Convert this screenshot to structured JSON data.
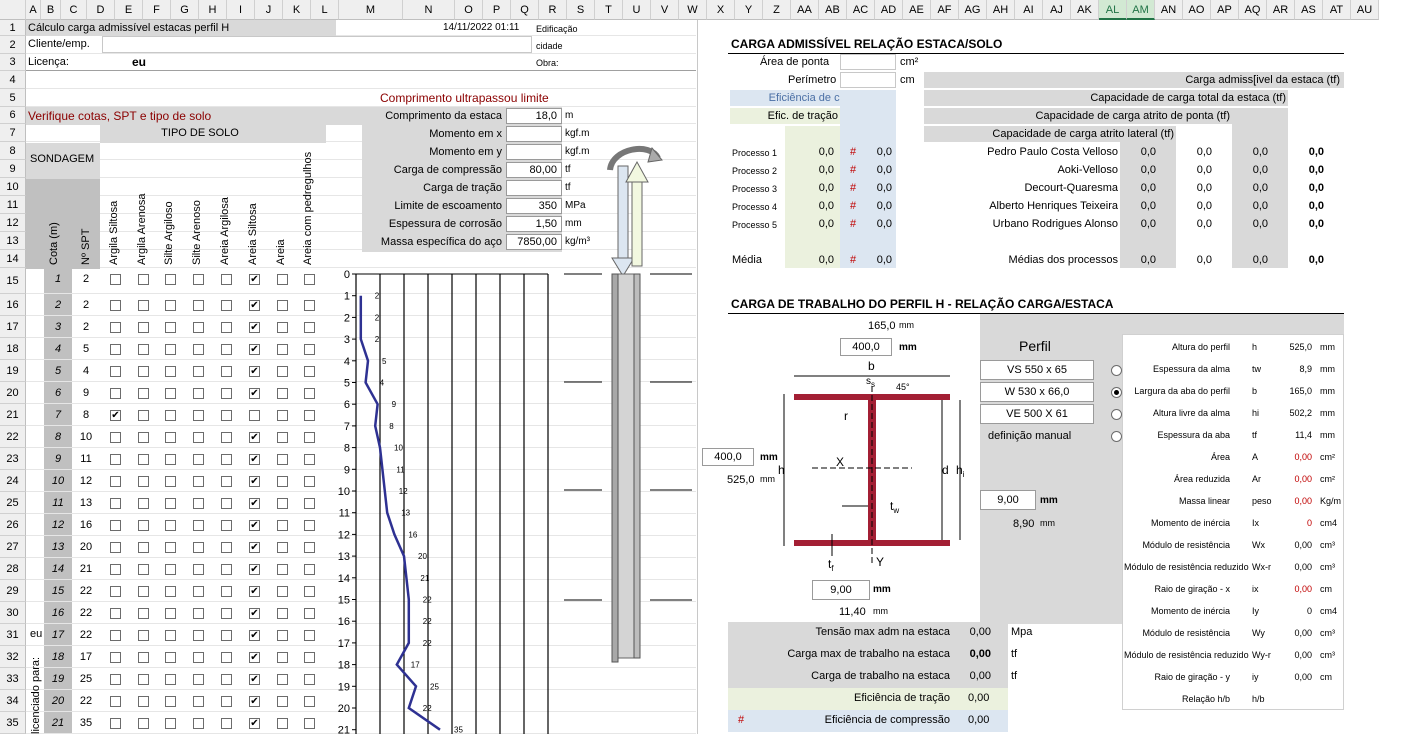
{
  "columns": [
    "A",
    "B",
    "C",
    "D",
    "E",
    "F",
    "G",
    "H",
    "I",
    "J",
    "K",
    "L",
    "M",
    "N",
    "O",
    "P",
    "Q",
    "R",
    "S",
    "T",
    "U",
    "V",
    "W",
    "X",
    "Y",
    "Z",
    "AA",
    "AB",
    "AC",
    "AD",
    "AE",
    "AF",
    "AG",
    "AH",
    "AI",
    "AJ",
    "AK",
    "AL",
    "AM",
    "AN",
    "AO",
    "AP",
    "AQ",
    "AR",
    "AS",
    "AT",
    "AU"
  ],
  "rows": [
    "1",
    "2",
    "3",
    "4",
    "5",
    "6",
    "7",
    "8",
    "9",
    "10",
    "11",
    "12",
    "13",
    "14",
    "15",
    "16",
    "17",
    "18",
    "19",
    "20",
    "21",
    "22",
    "23",
    "24",
    "25",
    "26",
    "27",
    "28",
    "29",
    "30",
    "31",
    "32",
    "33",
    "34",
    "35"
  ],
  "header": {
    "title": "Cálculo carga admissível estacas perfil H",
    "datetime": "14/11/2022 01:11",
    "edificacao_label": "Edificação",
    "cliente_label": "Cliente/emp.",
    "cidade_label": "cidade",
    "licenca_label": "Licença:",
    "licenca_value": "eu",
    "obra_label": "Obra:"
  },
  "warnings": {
    "comprimento": "Comprimento ultrapassou limite",
    "verifique": "Verifique cotas, SPT e tipo de solo"
  },
  "params": [
    {
      "label": "Comprimento da estaca",
      "value": "18,0",
      "unit": "m"
    },
    {
      "label": "Momento em x",
      "value": "",
      "unit": "kgf.m"
    },
    {
      "label": "Momento em y",
      "value": "",
      "unit": "kgf.m"
    },
    {
      "label": "Carga de compressão",
      "value": "80,00",
      "unit": "tf"
    },
    {
      "label": "Carga de tração",
      "value": "",
      "unit": "tf"
    },
    {
      "label": "Limite de escoamento",
      "value": "350",
      "unit": "MPa"
    },
    {
      "label": "Espessura de corrosão",
      "value": "1,50",
      "unit": "mm"
    },
    {
      "label": "Massa específica do aço",
      "value": "7850,00",
      "unit": "kg/m³"
    }
  ],
  "soil": {
    "tipo_label": "TIPO DE SOLO",
    "sondagem_label": "SONDAGEM",
    "cota_label": "Cota (m)",
    "spt_label": "Nº SPT",
    "types": [
      "Argila Siltosa",
      "Argila Arenosa",
      "Silte Argiloso",
      "Silte Arenoso",
      "Areia Argilosa",
      "Areia Siltosa",
      "Areia",
      "Areia com pedregulhos"
    ],
    "licenciado": "licenciado para:",
    "licenciado_value": "eu",
    "rows": [
      {
        "cota": "1",
        "spt": "2",
        "checked": 5
      },
      {
        "cota": "2",
        "spt": "2",
        "checked": 5
      },
      {
        "cota": "3",
        "spt": "2",
        "checked": 5
      },
      {
        "cota": "4",
        "spt": "5",
        "checked": 5
      },
      {
        "cota": "5",
        "spt": "4",
        "checked": 5
      },
      {
        "cota": "6",
        "spt": "9",
        "checked": 5
      },
      {
        "cota": "7",
        "spt": "8",
        "checked": 0
      },
      {
        "cota": "8",
        "spt": "10",
        "checked": 5
      },
      {
        "cota": "9",
        "spt": "11",
        "checked": 5
      },
      {
        "cota": "10",
        "spt": "12",
        "checked": 5
      },
      {
        "cota": "11",
        "spt": "13",
        "checked": 5
      },
      {
        "cota": "12",
        "spt": "16",
        "checked": 5
      },
      {
        "cota": "13",
        "spt": "20",
        "checked": 5
      },
      {
        "cota": "14",
        "spt": "21",
        "checked": 5
      },
      {
        "cota": "15",
        "spt": "22",
        "checked": 5
      },
      {
        "cota": "16",
        "spt": "22",
        "checked": 5
      },
      {
        "cota": "17",
        "spt": "22",
        "checked": 5
      },
      {
        "cota": "18",
        "spt": "17",
        "checked": 5
      },
      {
        "cota": "19",
        "spt": "25",
        "checked": 5
      },
      {
        "cota": "20",
        "spt": "22",
        "checked": 5
      },
      {
        "cota": "21",
        "spt": "35",
        "checked": 5
      }
    ]
  },
  "spt_chart": {
    "depth_ticks": [
      "0",
      "1",
      "2",
      "3",
      "4",
      "5",
      "6",
      "7",
      "8",
      "9",
      "10",
      "11",
      "12",
      "13",
      "14",
      "15",
      "16",
      "17",
      "18",
      "19",
      "20",
      "21"
    ],
    "spt_values": [
      2,
      2,
      2,
      5,
      4,
      9,
      8,
      10,
      11,
      12,
      13,
      16,
      20,
      21,
      22,
      22,
      22,
      17,
      25,
      22,
      35
    ],
    "spt_labels": [
      "2",
      "2",
      "2",
      "5",
      "4",
      "9",
      "8",
      "10",
      "11",
      "12",
      "13",
      "16",
      "20",
      "21",
      "22",
      "22",
      "22",
      "17",
      "25",
      "22",
      "35"
    ],
    "line_color": "#2e3192"
  },
  "carga_solo": {
    "heading": "CARGA ADMISSÍVEL RELAÇÃO ESTACA/SOLO",
    "area_ponta": "Área de ponta",
    "area_unit": "cm²",
    "perimetro": "Perímetro",
    "perim_unit": "cm",
    "carga_adm": "Carga admiss[ivel da estaca (tf)",
    "efic_comp": "Eficiência de compressão",
    "efic_tracao": "Efic. de tração",
    "cap_total": "Capacidade de carga total da estaca (tf)",
    "cap_ponta": "Capacidade de carga atrito de ponta (tf)",
    "cap_lateral": "Capacidade de carga atrito lateral (tf)",
    "processos": [
      {
        "label": "Processo 1",
        "v": "0,0",
        "h": "#",
        "e": "0,0",
        "name": "Pedro Paulo Costa Velloso",
        "a": "0,0",
        "b": "0,0",
        "c": "0,0",
        "d": "0,0"
      },
      {
        "label": "Processo 2",
        "v": "0,0",
        "h": "#",
        "e": "0,0",
        "name": "Aoki-Velloso",
        "a": "0,0",
        "b": "0,0",
        "c": "0,0",
        "d": "0,0"
      },
      {
        "label": "Processo 3",
        "v": "0,0",
        "h": "#",
        "e": "0,0",
        "name": "Decourt-Quaresma",
        "a": "0,0",
        "b": "0,0",
        "c": "0,0",
        "d": "0,0"
      },
      {
        "label": "Processo 4",
        "v": "0,0",
        "h": "#",
        "e": "0,0",
        "name": "Alberto Henriques Teixeira",
        "a": "0,0",
        "b": "0,0",
        "c": "0,0",
        "d": "0,0"
      },
      {
        "label": "Processo 5",
        "v": "0,0",
        "h": "#",
        "e": "0,0",
        "name": "Urbano Rodrigues Alonso",
        "a": "0,0",
        "b": "0,0",
        "c": "0,0",
        "d": "0,0"
      }
    ],
    "media": {
      "label": "Média",
      "v": "0,0",
      "h": "#",
      "e": "0,0",
      "name": "Médias dos processos",
      "a": "0,0",
      "b": "0,0",
      "c": "0,0",
      "d": "0,0"
    }
  },
  "perfil": {
    "heading": "CARGA DE TRABALHO DO PERFIL H - RELAÇÃO CARGA/ESTACA",
    "dim_top": "165,0",
    "dim_top_unit": "mm",
    "b_input": "400,0",
    "b_unit": "mm",
    "h_input": "400,0",
    "h_unit": "mm",
    "h_value": "525,0",
    "h_value_unit": "mm",
    "tw_input": "9,00",
    "tw_unit": "mm",
    "tw_value": "8,90",
    "tw_value_unit": "mm",
    "tf_input": "9,00",
    "tf_unit": "mm",
    "tf_value": "11,40",
    "tf_value_unit": "mm",
    "diagram": {
      "b": "b",
      "ss": "s",
      "ss_sub": "s",
      "angle": "45°",
      "r": "r",
      "x": "X",
      "d": "d",
      "hi": "h",
      "hi_sub": "i",
      "h": "h",
      "tw": "t",
      "tw_sub": "w",
      "tf": "t",
      "tf_sub": "f",
      "y": "Y"
    },
    "perfil_label": "Perfil",
    "options": [
      {
        "label": "VS 550 x 65",
        "selected": false
      },
      {
        "label": "W 530 x 66,0",
        "selected": true
      },
      {
        "label": "VE 500 X 61",
        "selected": false
      },
      {
        "label": "definição manual",
        "selected": false
      }
    ],
    "props": [
      {
        "label": "Altura do perfil",
        "sym": "h",
        "val": "525,0",
        "unit": "mm",
        "red": false
      },
      {
        "label": "Espessura da alma",
        "sym": "tw",
        "val": "8,9",
        "unit": "mm",
        "red": false
      },
      {
        "label": "Largura da aba do perfil",
        "sym": "b",
        "val": "165,0",
        "unit": "mm",
        "red": false
      },
      {
        "label": "Altura livre da alma",
        "sym": "hi",
        "val": "502,2",
        "unit": "mm",
        "red": false
      },
      {
        "label": "Espessura da aba",
        "sym": "tf",
        "val": "11,4",
        "unit": "mm",
        "red": false
      },
      {
        "label": "Área",
        "sym": "A",
        "val": "0,00",
        "unit": "cm²",
        "red": true
      },
      {
        "label": "Área reduzida",
        "sym": "Ar",
        "val": "0,00",
        "unit": "cm²",
        "red": true
      },
      {
        "label": "Massa linear",
        "sym": "peso",
        "val": "0,00",
        "unit": "Kg/m",
        "red": true
      },
      {
        "label": "Momento de inércia",
        "sym": "Ix",
        "val": "0",
        "unit": "cm4",
        "red": true
      },
      {
        "label": "Módulo de resistência",
        "sym": "Wx",
        "val": "0,00",
        "unit": "cm³",
        "red": false
      },
      {
        "label": "Módulo de resistência reduzido",
        "sym": "Wx-r",
        "val": "0,00",
        "unit": "cm³",
        "red": false
      },
      {
        "label": "Raio de giração - x",
        "sym": "ix",
        "val": "0,00",
        "unit": "cm",
        "red": true
      },
      {
        "label": "Momento de inércia",
        "sym": "Iy",
        "val": "0",
        "unit": "cm4",
        "red": false
      },
      {
        "label": "Módulo de resistência",
        "sym": "Wy",
        "val": "0,00",
        "unit": "cm³",
        "red": false
      },
      {
        "label": "Módulo de resistência reduzido",
        "sym": "Wy-r",
        "val": "0,00",
        "unit": "cm³",
        "red": false
      },
      {
        "label": "Raio de giração - y",
        "sym": "iy",
        "val": "0,00",
        "unit": "cm",
        "red": false
      },
      {
        "label": "Relação h/b",
        "sym": "h/b",
        "val": "",
        "unit": "",
        "red": false
      }
    ],
    "results": [
      {
        "label": "Tensão max adm na estaca",
        "val": "0,00",
        "unit": "Mpa",
        "bold": false
      },
      {
        "label": "Carga max de trabalho na estaca",
        "val": "0,00",
        "unit": "tf",
        "bold": true
      },
      {
        "label": "Carga de trabalho na estaca",
        "val": "0,00",
        "unit": "tf",
        "bold": false
      }
    ],
    "efic_tracao": {
      "label": "Eficiência de tração",
      "val": "0,00"
    },
    "efic_comp": {
      "hash": "#",
      "label": "Eficiência de compressão",
      "val": "0,00"
    }
  },
  "colors": {
    "header_bg": "#efefef",
    "grey": "#d9d9d9",
    "light_green": "#ebf1de",
    "light_blue": "#dce6f1",
    "flange": "#a31f34",
    "spt_line": "#2e3192"
  }
}
